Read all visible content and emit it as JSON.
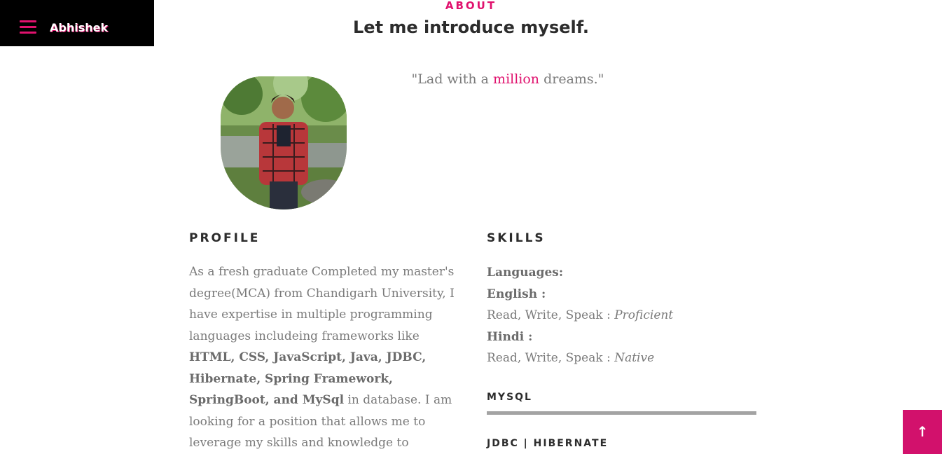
{
  "header": {
    "brand_name": "Abhishek",
    "menu_icon": "hamburger-menu-icon"
  },
  "about": {
    "section_label": "ABOUT",
    "title": "Let me introduce myself.",
    "quote_before": "\"Lad with a ",
    "quote_accent": "million",
    "quote_after": " dreams.\"",
    "avatar_alt": "profile photo"
  },
  "profile": {
    "heading": "PROFILE",
    "text_1": "As a fresh graduate Completed my master's degree(MCA) from Chandigarh University, I have expertise in multiple programming languages includeing frameworks like ",
    "text_bold": "HTML, CSS, JavaScript, Java, JDBC, Hibernate, Spring Framework, SpringBoot, and MySql",
    "text_2": " in database. I am looking for a position that allows me to leverage my skills and knowledge to contribute to the growth of an organization."
  },
  "skills": {
    "heading": "SKILLS",
    "languages_label": "Languages:",
    "english_label": "English :",
    "english_detail": "Read, Write, Speak : ",
    "english_level": "Proficient",
    "hindi_label": "Hindi :",
    "hindi_detail": "Read, Write, Speak : ",
    "hindi_level": "Native",
    "items": [
      {
        "name": "MYSQL"
      },
      {
        "name": "JDBC | HIBERNATE"
      }
    ]
  },
  "back_to_top": {
    "label": "↑",
    "icon": "arrow-up-icon"
  },
  "colors": {
    "accent": "#e0126e",
    "button": "#d2116c",
    "bar": "#a3a3a3"
  }
}
